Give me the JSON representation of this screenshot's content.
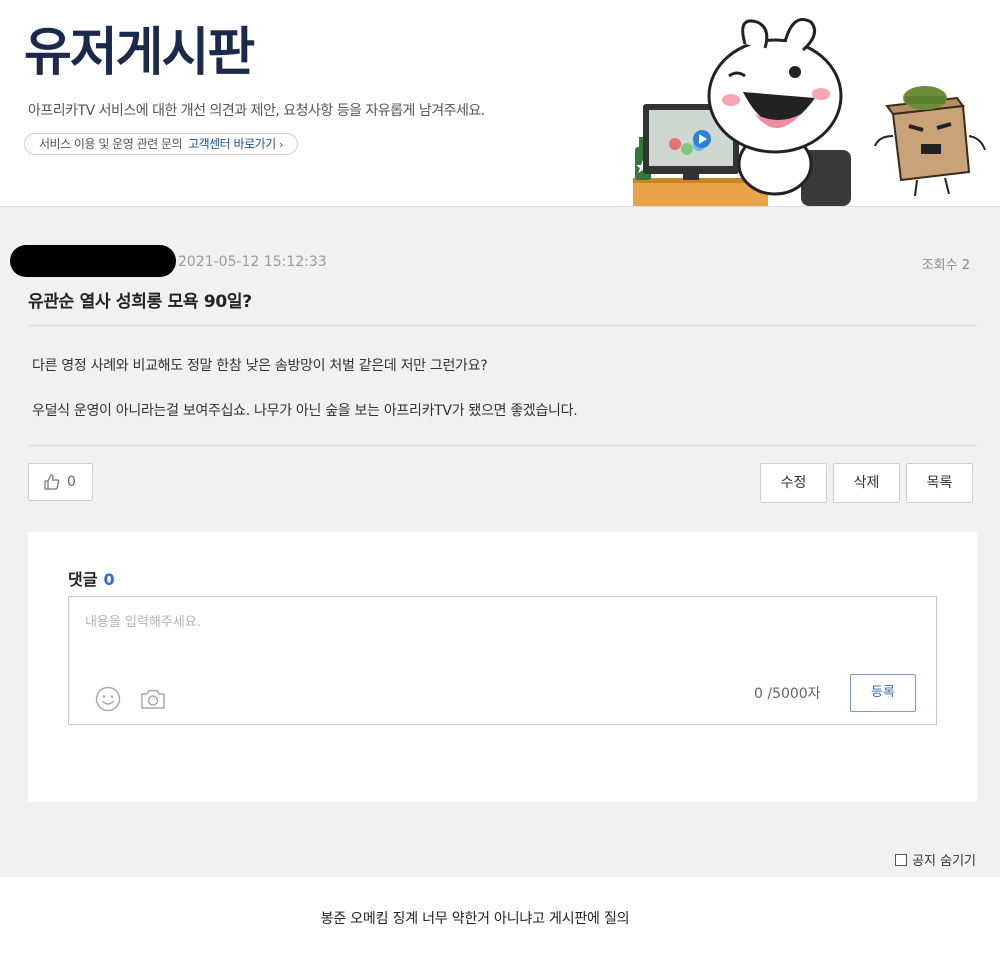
{
  "header": {
    "title": "유저게시판",
    "description": "아프리카TV 서비스에 대한 개선 의견과 제안, 요청사항 등을 자유롭게 남겨주세요.",
    "cs_text": "서비스 이용 및 운영 관련 문의",
    "cs_link": "고객센터 바로가기",
    "cs_chevron": "›"
  },
  "post": {
    "date": "2021-05-12 15:12:33",
    "views": "조회수 2",
    "title": "유관순 열사 성희롱 모욕 90일?",
    "paragraphs": [
      "다른 영정 사례와 비교해도 정말 한참 낮은 솜방망이 처벌 같은데 저만 그런가요?",
      "우덜식 운영이 아니라는걸 보여주십쇼. 나무가 아닌 숲을 보는 아프리카TV가 됐으면 좋겠습니다."
    ],
    "like_count": "0"
  },
  "actions": {
    "edit": "수정",
    "delete": "삭제",
    "list": "목록"
  },
  "comments": {
    "heading": "댓글",
    "count": "0",
    "placeholder": "내용을 입력해주세요.",
    "char_count": "0 /5000자",
    "submit": "등록"
  },
  "notice_toggle": "공지 숨기기",
  "caption": "봉준 오메킴 징계 너무 약한거 아니냐고 게시판에 질의",
  "colors": {
    "title_navy": "#1b2a4a",
    "link_blue": "#2c6fd1",
    "panel_gray": "#f1f1f1"
  }
}
